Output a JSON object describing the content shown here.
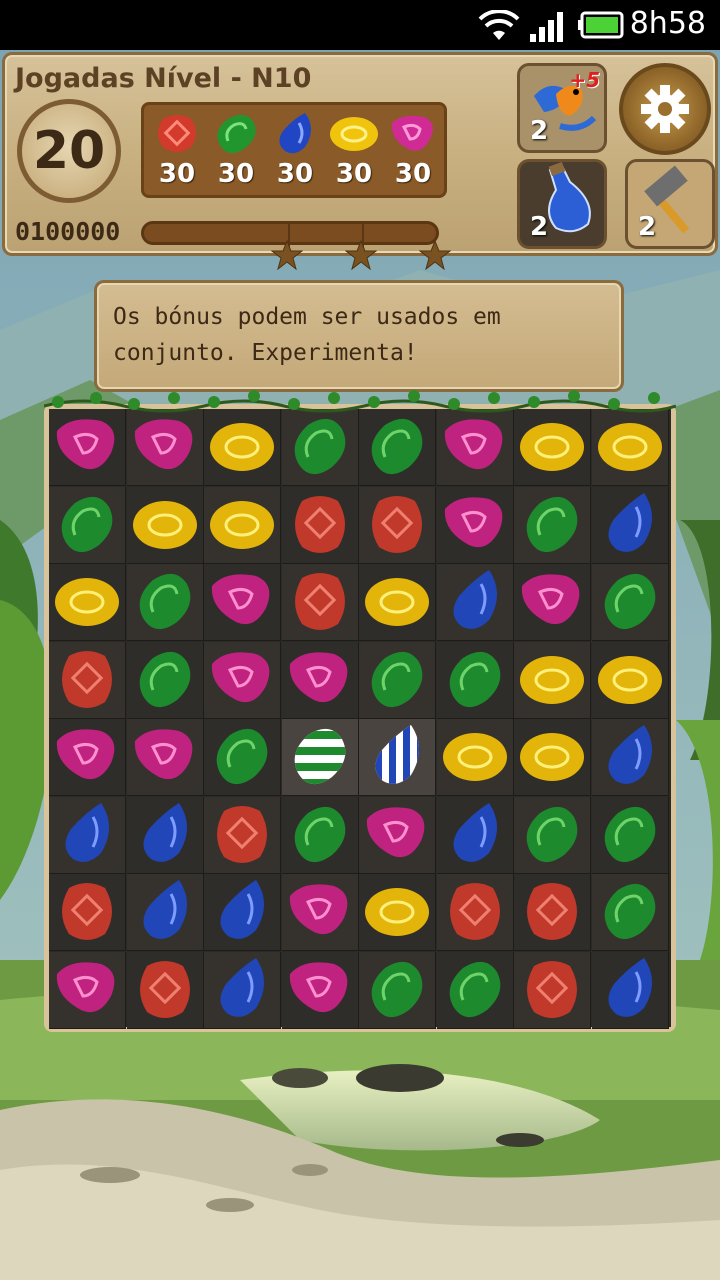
{
  "status_bar": {
    "time": "8h58"
  },
  "hud": {
    "level_title": "Jogadas Nível - N10",
    "moves_left": "20",
    "targets": [
      {
        "gem": "red",
        "count": "30"
      },
      {
        "gem": "green",
        "count": "30"
      },
      {
        "gem": "blue",
        "count": "30"
      },
      {
        "gem": "yellow",
        "count": "30"
      },
      {
        "gem": "magenta",
        "count": "30"
      }
    ],
    "score": "0100000",
    "progress": 0,
    "boosters": [
      {
        "name": "extra-moves",
        "count": "2",
        "badge": "+5"
      },
      {
        "name": "potion",
        "count": "2"
      },
      {
        "name": "hammer",
        "count": "2"
      }
    ]
  },
  "tip": {
    "text": "Os bónus podem ser usados em conjunto. Experimenta!"
  },
  "colors": {
    "red": "#c0392b",
    "green": "#1e8a2e",
    "blue": "#2146b8",
    "yellow": "#e3b40a",
    "magenta": "#c0237f",
    "wood": "#c8b080"
  },
  "board": {
    "rows": [
      [
        "M",
        "M",
        "Y",
        "G",
        "G",
        "M",
        "Y",
        "Y"
      ],
      [
        "G",
        "Y",
        "Y",
        "R",
        "R",
        "M",
        "G",
        "B"
      ],
      [
        "Y",
        "G",
        "M",
        "R",
        "Y",
        "B",
        "M",
        "G"
      ],
      [
        "R",
        "G",
        "M",
        "M",
        "G",
        "G",
        "Y",
        "Y"
      ],
      [
        "M",
        "M",
        "G",
        "GS",
        "BS",
        "Y",
        "Y",
        "B"
      ],
      [
        "B",
        "B",
        "R",
        "G",
        "M",
        "B",
        "G",
        "G"
      ],
      [
        "R",
        "B",
        "B",
        "M",
        "Y",
        "R",
        "R",
        "G"
      ],
      [
        "M",
        "R",
        "B",
        "M",
        "G",
        "G",
        "R",
        "B"
      ]
    ],
    "legend": {
      "R": "red",
      "G": "green",
      "B": "blue",
      "Y": "yellow",
      "M": "magenta",
      "GS": "green-striped",
      "BS": "blue-striped"
    }
  }
}
